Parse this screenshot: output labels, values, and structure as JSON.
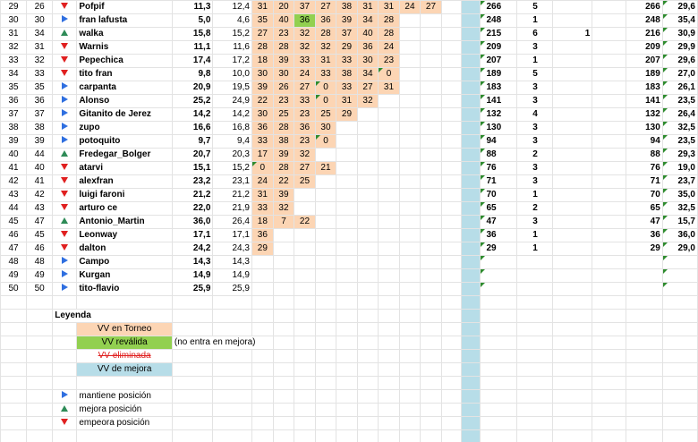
{
  "rows": [
    {
      "pos": "29",
      "prev": "26",
      "trend": "down",
      "name": "Pofpif",
      "a": "11,3",
      "b": "12,4",
      "vv": [
        "31",
        "20",
        "37",
        "27",
        "38",
        "31",
        "31",
        "24",
        "27"
      ],
      "rev": -1,
      "pts": "266",
      "n": "5",
      "x": "",
      "pts2": "266",
      "avg": "29,6"
    },
    {
      "pos": "30",
      "prev": "30",
      "trend": "same",
      "name": "fran lafusta",
      "a": "5,0",
      "b": "4,6",
      "vv": [
        "35",
        "40",
        "36",
        "36",
        "39",
        "34",
        "28"
      ],
      "rev": 2,
      "pts": "248",
      "n": "1",
      "x": "",
      "pts2": "248",
      "avg": "35,4"
    },
    {
      "pos": "31",
      "prev": "34",
      "trend": "up",
      "name": "walka",
      "a": "15,8",
      "b": "15,2",
      "vv": [
        "27",
        "23",
        "32",
        "28",
        "37",
        "40",
        "28"
      ],
      "rev": -1,
      "pts": "215",
      "n": "6",
      "x": "1",
      "pts2": "216",
      "avg": "30,9"
    },
    {
      "pos": "32",
      "prev": "31",
      "trend": "down",
      "name": "Warnis",
      "a": "11,1",
      "b": "11,6",
      "vv": [
        "28",
        "28",
        "32",
        "32",
        "29",
        "36",
        "24"
      ],
      "rev": -1,
      "pts": "209",
      "n": "3",
      "x": "",
      "pts2": "209",
      "avg": "29,9"
    },
    {
      "pos": "33",
      "prev": "32",
      "trend": "down",
      "name": "Pepechica",
      "a": "17,4",
      "b": "17,2",
      "vv": [
        "18",
        "39",
        "33",
        "31",
        "33",
        "30",
        "23"
      ],
      "rev": -1,
      "pts": "207",
      "n": "1",
      "x": "",
      "pts2": "207",
      "avg": "29,6"
    },
    {
      "pos": "34",
      "prev": "33",
      "trend": "down",
      "name": "tito fran",
      "a": "9,8",
      "b": "10,0",
      "vv": [
        "30",
        "30",
        "24",
        "33",
        "38",
        "34",
        "0"
      ],
      "rev": -1,
      "pts": "189",
      "n": "5",
      "x": "",
      "pts2": "189",
      "avg": "27,0"
    },
    {
      "pos": "35",
      "prev": "35",
      "trend": "same",
      "name": "carpanta",
      "a": "20,9",
      "b": "19,5",
      "vv": [
        "39",
        "26",
        "27",
        "0",
        "33",
        "27",
        "31"
      ],
      "rev": -1,
      "pts": "183",
      "n": "3",
      "x": "",
      "pts2": "183",
      "avg": "26,1"
    },
    {
      "pos": "36",
      "prev": "36",
      "trend": "same",
      "name": "Alonso",
      "a": "25,2",
      "b": "24,9",
      "vv": [
        "22",
        "23",
        "33",
        "0",
        "31",
        "32"
      ],
      "rev": -1,
      "pts": "141",
      "n": "3",
      "x": "",
      "pts2": "141",
      "avg": "23,5"
    },
    {
      "pos": "37",
      "prev": "37",
      "trend": "same",
      "name": "Gitanito de Jerez",
      "a": "14,2",
      "b": "14,2",
      "vv": [
        "30",
        "25",
        "23",
        "25",
        "29"
      ],
      "rev": -1,
      "pts": "132",
      "n": "4",
      "x": "",
      "pts2": "132",
      "avg": "26,4"
    },
    {
      "pos": "38",
      "prev": "38",
      "trend": "same",
      "name": "zupo",
      "a": "16,6",
      "b": "16,8",
      "vv": [
        "36",
        "28",
        "36",
        "30"
      ],
      "rev": -1,
      "pts": "130",
      "n": "3",
      "x": "",
      "pts2": "130",
      "avg": "32,5"
    },
    {
      "pos": "39",
      "prev": "39",
      "trend": "same",
      "name": "potoquito",
      "a": "9,7",
      "b": "9,4",
      "vv": [
        "33",
        "38",
        "23",
        "0"
      ],
      "rev": -1,
      "pts": "94",
      "n": "3",
      "x": "",
      "pts2": "94",
      "avg": "23,5"
    },
    {
      "pos": "40",
      "prev": "44",
      "trend": "up",
      "name": "Fredegar_Bolger",
      "a": "20,7",
      "b": "20,3",
      "vv": [
        "17",
        "39",
        "32"
      ],
      "rev": -1,
      "pts": "88",
      "n": "2",
      "x": "",
      "pts2": "88",
      "avg": "29,3"
    },
    {
      "pos": "41",
      "prev": "40",
      "trend": "down",
      "name": "atarvi",
      "a": "15,1",
      "b": "15,2",
      "vv": [
        "0",
        "28",
        "27",
        "21"
      ],
      "rev": -1,
      "pts": "76",
      "n": "3",
      "x": "",
      "pts2": "76",
      "avg": "19,0"
    },
    {
      "pos": "42",
      "prev": "41",
      "trend": "down",
      "name": "alexfran",
      "a": "23,2",
      "b": "23,1",
      "vv": [
        "24",
        "22",
        "25"
      ],
      "rev": -1,
      "pts": "71",
      "n": "3",
      "x": "",
      "pts2": "71",
      "avg": "23,7"
    },
    {
      "pos": "43",
      "prev": "42",
      "trend": "down",
      "name": "luigi faroni",
      "a": "21,2",
      "b": "21,2",
      "vv": [
        "31",
        "39"
      ],
      "rev": -1,
      "pts": "70",
      "n": "1",
      "x": "",
      "pts2": "70",
      "avg": "35,0"
    },
    {
      "pos": "44",
      "prev": "43",
      "trend": "down",
      "name": "arturo ce",
      "a": "22,0",
      "b": "21,9",
      "vv": [
        "33",
        "32"
      ],
      "rev": -1,
      "pts": "65",
      "n": "2",
      "x": "",
      "pts2": "65",
      "avg": "32,5"
    },
    {
      "pos": "45",
      "prev": "47",
      "trend": "up",
      "name": "Antonio_Martin",
      "a": "36,0",
      "b": "26,4",
      "vv": [
        "18",
        "7",
        "22"
      ],
      "rev": -1,
      "pts": "47",
      "n": "3",
      "x": "",
      "pts2": "47",
      "avg": "15,7"
    },
    {
      "pos": "46",
      "prev": "45",
      "trend": "down",
      "name": "Leonway",
      "a": "17,1",
      "b": "17,1",
      "vv": [
        "36"
      ],
      "rev": -1,
      "pts": "36",
      "n": "1",
      "x": "",
      "pts2": "36",
      "avg": "36,0"
    },
    {
      "pos": "47",
      "prev": "46",
      "trend": "down",
      "name": "dalton",
      "a": "24,2",
      "b": "24,3",
      "vv": [
        "29"
      ],
      "rev": -1,
      "pts": "29",
      "n": "1",
      "x": "",
      "pts2": "29",
      "avg": "29,0"
    },
    {
      "pos": "48",
      "prev": "48",
      "trend": "same",
      "name": "Campo",
      "a": "14,3",
      "b": "14,3",
      "vv": [],
      "rev": -1,
      "pts": "",
      "n": "",
      "x": "",
      "pts2": "",
      "avg": ""
    },
    {
      "pos": "49",
      "prev": "49",
      "trend": "same",
      "name": "Kurgan",
      "a": "14,9",
      "b": "14,9",
      "vv": [],
      "rev": -1,
      "pts": "",
      "n": "",
      "x": "",
      "pts2": "",
      "avg": ""
    },
    {
      "pos": "50",
      "prev": "50",
      "trend": "same",
      "name": "tito-flavio",
      "a": "25,9",
      "b": "25,9",
      "vv": [],
      "rev": -1,
      "pts": "",
      "n": "",
      "x": "",
      "pts2": "",
      "avg": ""
    }
  ],
  "legend": {
    "title": "Leyenda",
    "vv_torneo": "VV en Torneo",
    "vv_revalida": "VV reválida",
    "vv_revalida_note": "(no entra en mejora)",
    "vv_eliminada": "VV eliminada",
    "vv_mejora": "VV de mejora",
    "mantiene": "mantiene posición",
    "mejora": "mejora posición",
    "empeora": "empeora posición"
  },
  "colors": {
    "vv_torneo": "#fcd5b4",
    "vv_revalida": "#92d050",
    "vv_mejora": "#b7dde8",
    "up": "#2e8b57",
    "down": "#e02020",
    "same": "#2f6fe0"
  }
}
